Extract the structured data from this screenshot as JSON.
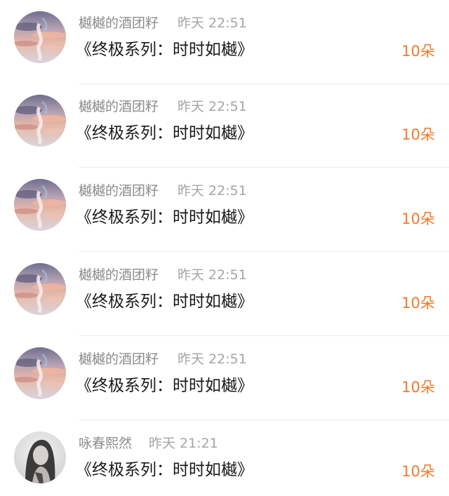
{
  "comments": [
    {
      "avatar": "sunset-sky-avatar",
      "username": "樾樾的酒团籽",
      "time": "昨天 22:51",
      "title": "《终极系列：时时如樾》",
      "gift": "10朵"
    },
    {
      "avatar": "sunset-sky-avatar",
      "username": "樾樾的酒团籽",
      "time": "昨天 22:51",
      "title": "《终极系列：时时如樾》",
      "gift": "10朵"
    },
    {
      "avatar": "sunset-sky-avatar",
      "username": "樾樾的酒团籽",
      "time": "昨天 22:51",
      "title": "《终极系列：时时如樾》",
      "gift": "10朵"
    },
    {
      "avatar": "sunset-sky-avatar",
      "username": "樾樾的酒团籽",
      "time": "昨天 22:51",
      "title": "《终极系列：时时如樾》",
      "gift": "10朵"
    },
    {
      "avatar": "sunset-sky-avatar",
      "username": "樾樾的酒团籽",
      "time": "昨天 22:51",
      "title": "《终极系列：时时如樾》",
      "gift": "10朵"
    },
    {
      "avatar": "grayscale-portrait-avatar",
      "username": "咏春熙然",
      "time": "昨天 21:21",
      "title": "《终极系列：时时如樾》",
      "gift": "10朵"
    }
  ],
  "colors": {
    "gift_accent": "#f07a2a",
    "username": "#8c8c8c",
    "timestamp": "#a5a5a5",
    "title_text": "#1a1a1a"
  }
}
